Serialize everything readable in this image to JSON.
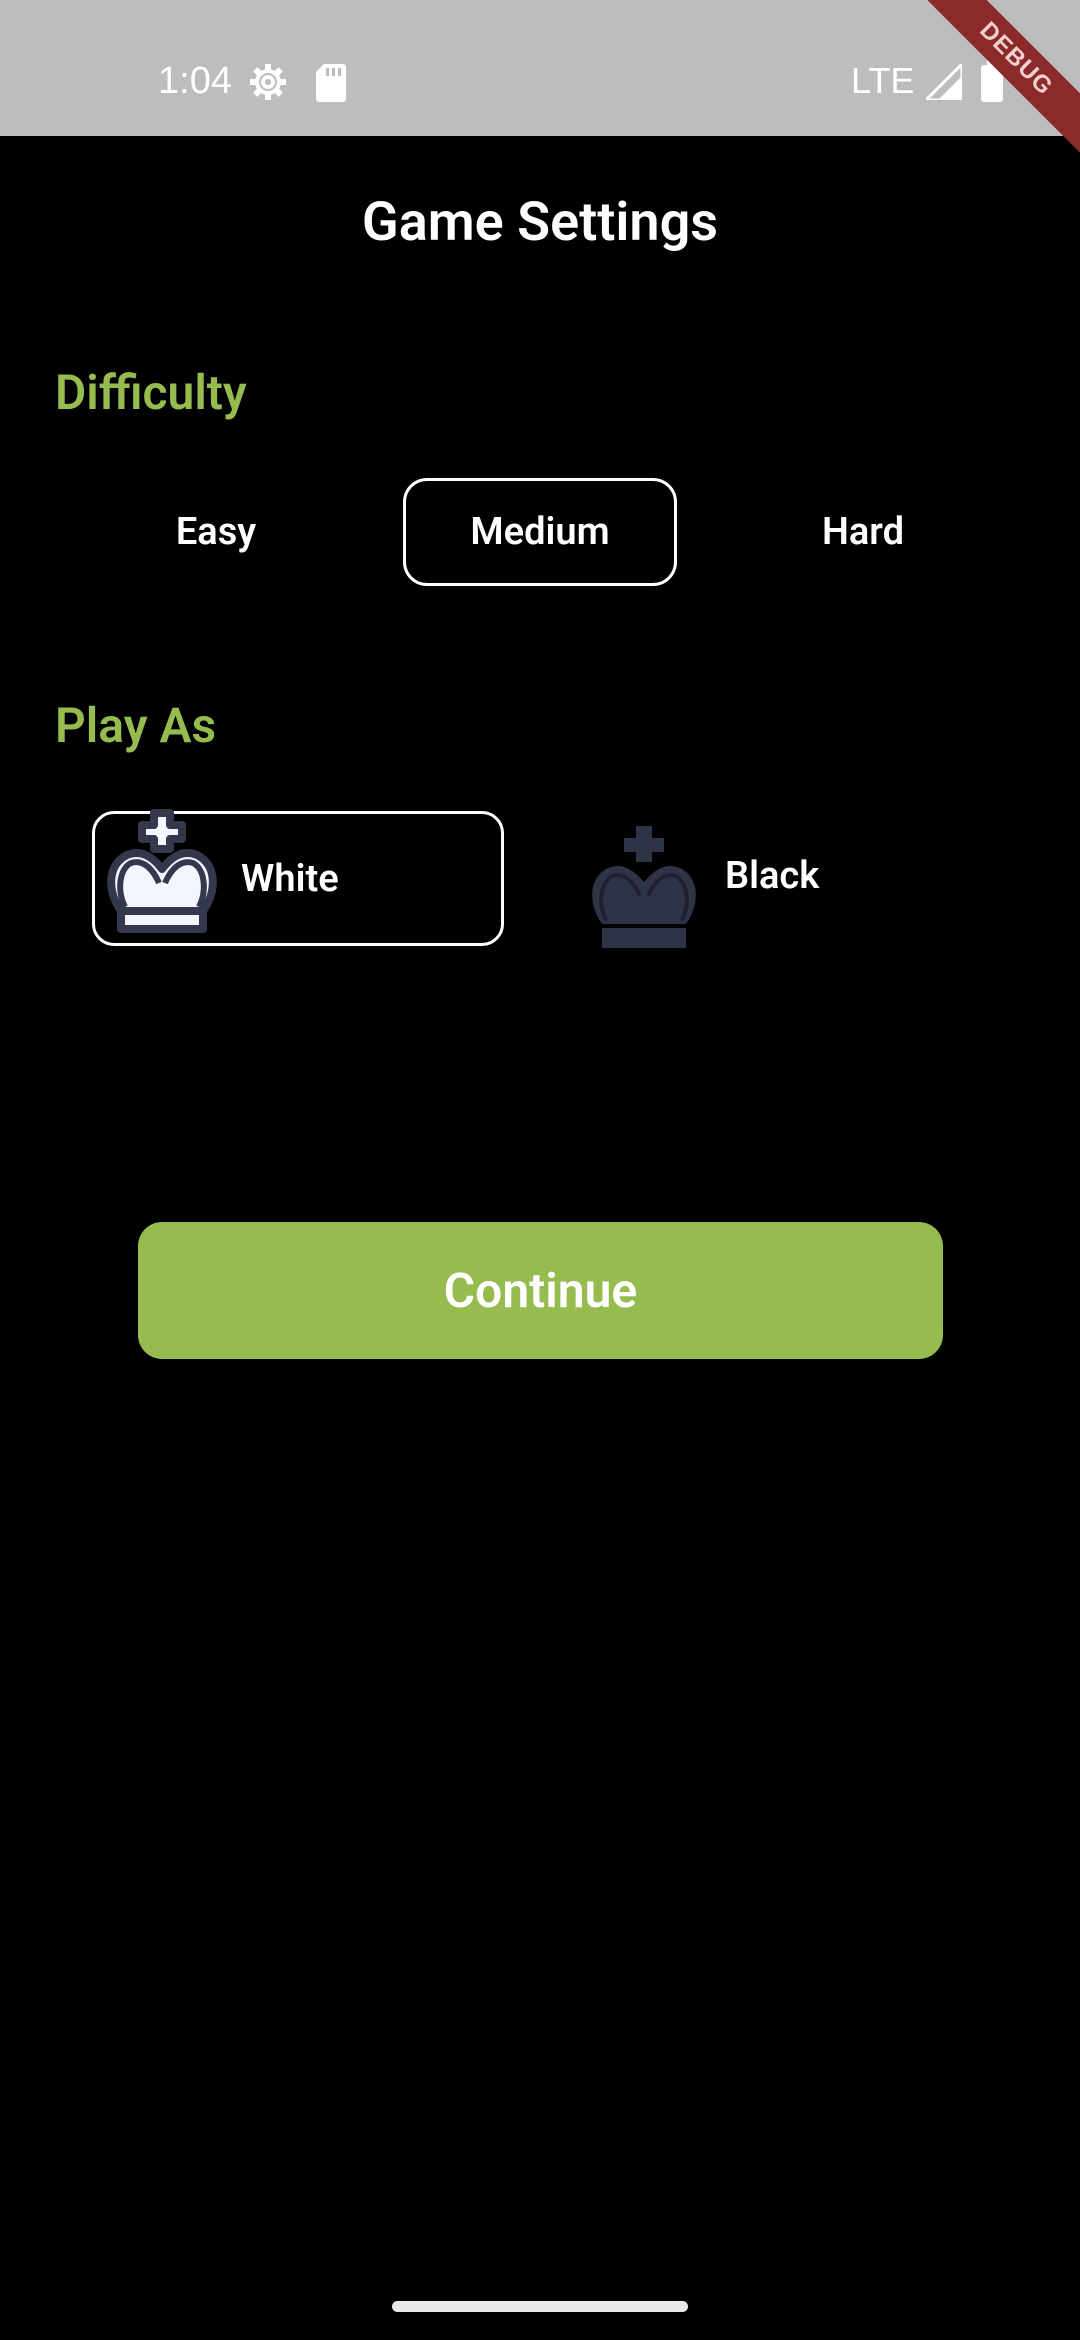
{
  "status_bar": {
    "time": "1:04",
    "network": "LTE",
    "icons": [
      "gear-icon",
      "sd-card-icon",
      "signal-icon",
      "battery-icon"
    ]
  },
  "debug_banner": "DEBUG",
  "header": {
    "title": "Game Settings"
  },
  "difficulty": {
    "label": "Difficulty",
    "options": [
      "Easy",
      "Medium",
      "Hard"
    ],
    "selected": "Medium"
  },
  "play_as": {
    "label": "Play As",
    "options": [
      {
        "label": "White",
        "icon": "white-king-icon"
      },
      {
        "label": "Black",
        "icon": "black-king-icon"
      }
    ],
    "selected": "White"
  },
  "continue_button": {
    "label": "Continue"
  },
  "colors": {
    "accent": "#96bb4f",
    "background": "#000000",
    "status_bar": "#bdbdbd",
    "black_piece": "#2f3347"
  }
}
